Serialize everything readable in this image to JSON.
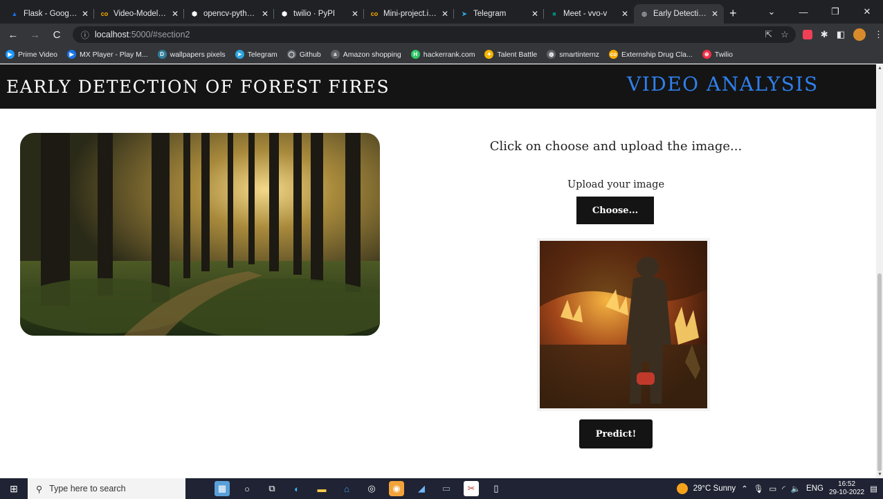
{
  "browser": {
    "tabs": [
      {
        "label": "Flask - Google Dr",
        "icon": "google-drive-icon",
        "color": "#1a73e8",
        "glyph": "▲"
      },
      {
        "label": "Video-Model-Tes",
        "icon": "colab-icon",
        "color": "#f9ab00",
        "glyph": "co"
      },
      {
        "label": "opencv-python -",
        "icon": "pypi-icon",
        "color": "#ffffff",
        "glyph": "⬢"
      },
      {
        "label": "twilio · PyPI",
        "icon": "pypi-icon",
        "color": "#ffffff",
        "glyph": "⬢"
      },
      {
        "label": "Mini-project.ipyn",
        "icon": "colab-icon",
        "color": "#f9ab00",
        "glyph": "co"
      },
      {
        "label": "Telegram",
        "icon": "telegram-icon",
        "color": "#2ca5e0",
        "glyph": "➤"
      },
      {
        "label": "Meet - vvo-v",
        "icon": "meet-icon",
        "color": "#00897b",
        "glyph": "■"
      },
      {
        "label": "Early Detection o",
        "icon": "globe-icon",
        "color": "#9aa0a6",
        "glyph": "◍",
        "active": true
      }
    ],
    "new_tab": "+",
    "url": {
      "host": "localhost",
      "rest": ":5000/#section2"
    },
    "bookmarks": [
      {
        "label": "Prime Video",
        "icon": "prime-video-icon",
        "color": "#1a98ff",
        "glyph": "▶"
      },
      {
        "label": "MX Player - Play M...",
        "icon": "mx-player-icon",
        "color": "#1a73e8",
        "glyph": "▶"
      },
      {
        "label": "wallpapers pixels",
        "icon": "wallpaper-icon",
        "color": "#2e7d9a",
        "glyph": "D"
      },
      {
        "label": "Telegram",
        "icon": "telegram-icon",
        "color": "#2ca5e0",
        "glyph": "➤"
      },
      {
        "label": "Github",
        "icon": "github-icon",
        "color": "#ffffff",
        "glyph": "◯"
      },
      {
        "label": "Amazon shopping",
        "icon": "amazon-icon",
        "color": "#ffffff",
        "glyph": "a"
      },
      {
        "label": "hackerrank.com",
        "icon": "hackerrank-icon",
        "color": "#2ec866",
        "glyph": "H"
      },
      {
        "label": "Talent Battle",
        "icon": "talent-battle-icon",
        "color": "#f4b400",
        "glyph": "✦"
      },
      {
        "label": "smartinternz",
        "icon": "globe-icon",
        "color": "#ffffff",
        "glyph": "◍"
      },
      {
        "label": "Externship Drug Cla...",
        "icon": "colab-icon",
        "color": "#f9ab00",
        "glyph": "co"
      },
      {
        "label": "Twilio",
        "icon": "twilio-icon",
        "color": "#f22f46",
        "glyph": "⊕"
      }
    ]
  },
  "site": {
    "title": "EARLY DETECTION OF FOREST FIRES",
    "nav_link": "VIDEO ANALYSIS",
    "instruction": "Click on choose and upload the image...",
    "upload_label": "Upload your image",
    "choose_button": "Choose...",
    "predict_button": "Predict!",
    "colors": {
      "header_bg": "#141414",
      "nav_link": "#2f80ed",
      "button_bg": "#141414"
    }
  },
  "taskbar": {
    "search_placeholder": "Type here to search",
    "weather": "29°C  Sunny",
    "language": "ENG",
    "time": "16:52",
    "date": "29-10-2022"
  }
}
